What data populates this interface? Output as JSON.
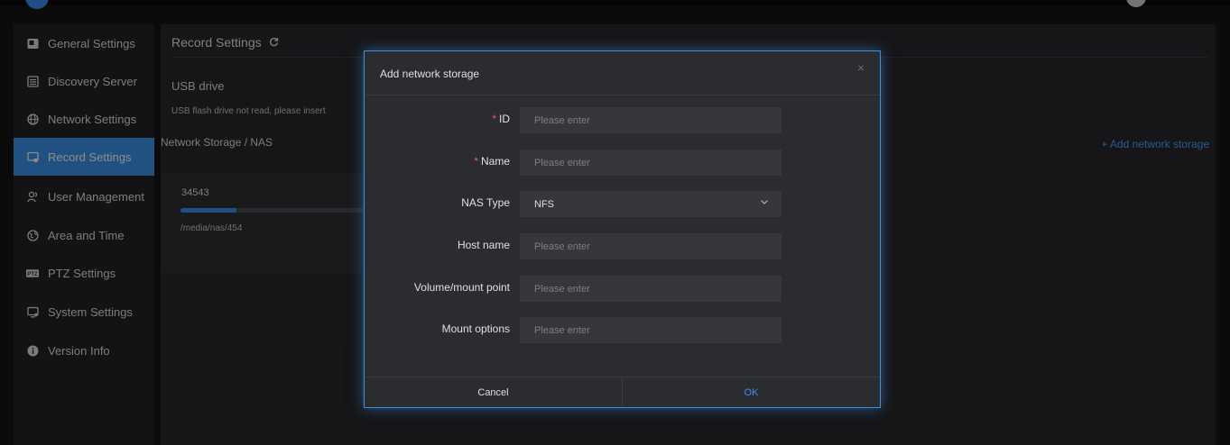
{
  "sidebar": {
    "items": [
      {
        "label": "General Settings",
        "icon": "general-settings-icon",
        "active": false
      },
      {
        "label": "Discovery Server",
        "icon": "discovery-server-icon",
        "active": false
      },
      {
        "label": "Network Settings",
        "icon": "globe-icon",
        "active": false
      },
      {
        "label": "Record Settings",
        "icon": "record-settings-icon",
        "active": true
      },
      {
        "label": "User Management",
        "icon": "users-icon",
        "active": false
      },
      {
        "label": "Area and Time",
        "icon": "globe-clock-icon",
        "active": false
      },
      {
        "label": "PTZ Settings",
        "icon": "ptz-icon",
        "active": false
      },
      {
        "label": "System Settings",
        "icon": "system-settings-icon",
        "active": false
      },
      {
        "label": "Version Info",
        "icon": "info-icon",
        "active": false
      }
    ]
  },
  "main": {
    "title": "Record Settings",
    "usb_title": "USB drive",
    "usb_message": "USB flash drive not read, please insert",
    "nas_title": "Network Storage / NAS",
    "add_nas_label": "+ Add network storage",
    "nas_card": {
      "name": "34543",
      "path": "/media/nas/454",
      "usage_fraction": 0.3
    }
  },
  "dialog": {
    "title": "Add network storage",
    "close_glyph": "×",
    "required_mark": "*",
    "fields": {
      "id": {
        "label": "ID",
        "placeholder": "Please enter",
        "required": true
      },
      "name": {
        "label": "Name",
        "placeholder": "Please enter",
        "required": true
      },
      "nas_type": {
        "label": "NAS Type",
        "value": "NFS"
      },
      "host_name": {
        "label": "Host name",
        "placeholder": "Please enter"
      },
      "volume": {
        "label": "Volume/mount point",
        "placeholder": "Please enter"
      },
      "mount_options": {
        "label": "Mount options",
        "placeholder": "Please enter"
      }
    },
    "cancel_label": "Cancel",
    "ok_label": "OK"
  },
  "colors": {
    "accent": "#3b94ec",
    "required": "#f05a5a",
    "link": "#4aa3ff"
  }
}
